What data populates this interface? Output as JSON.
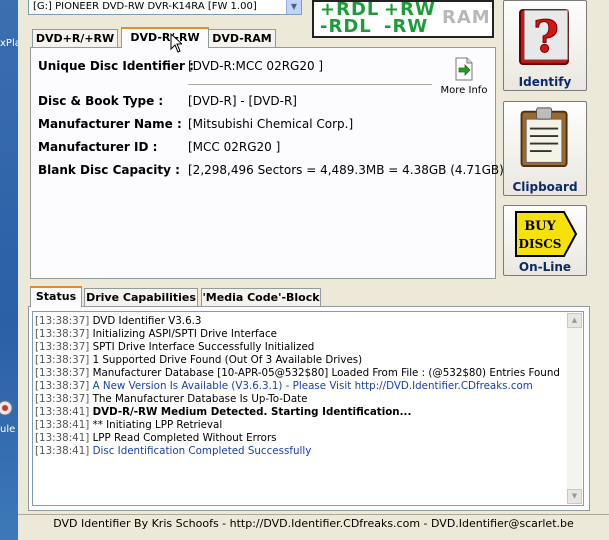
{
  "desktop": {
    "top_label": "xPla",
    "bottom_label": "ule"
  },
  "drive": {
    "selected": "[G:] PIONEER DVD-RW  DVR-K14RA [FW 1.00]"
  },
  "formats": {
    "plus_rdl": "+RDL",
    "plus_rw": "+RW",
    "minus_rdl": "-RDL",
    "minus_rw": "-RW",
    "ram": "RAM"
  },
  "tabs": {
    "t1": "DVD+R/+RW",
    "t2": "DVD-R/-RW",
    "t3": "DVD-RAM"
  },
  "disc": {
    "udi_label": "Unique Disc Identifier :",
    "udi_value": "[DVD-R:MCC 02RG20  ]",
    "more_info": "More Info",
    "type_label": "Disc & Book Type :",
    "type_value": "[DVD-R] - [DVD-R]",
    "mfr_label": "Manufacturer Name :",
    "mfr_value": "[Mitsubishi Chemical Corp.]",
    "mfrid_label": "Manufacturer ID :",
    "mfrid_value": "[MCC 02RG20  ]",
    "cap_label": "Blank Disc Capacity :",
    "cap_value": "[2,298,496 Sectors = 4,489.3MB = 4.38GB (4.71GB)]"
  },
  "side_buttons": {
    "identify": "Identify",
    "clipboard": "Clipboard",
    "online": "On-Line",
    "buy_text1": "BUY",
    "buy_text2": "DISCS"
  },
  "bottom_tabs": {
    "status": "Status",
    "caps": "Drive Capabilities",
    "media": "'Media Code'-Block"
  },
  "log": [
    {
      "ts": "[13:38:37]",
      "msg": "DVD Identifier V3.6.3",
      "style": ""
    },
    {
      "ts": "[13:38:37]",
      "msg": "Initializing ASPI/SPTI Drive Interface",
      "style": ""
    },
    {
      "ts": "[13:38:37]",
      "msg": "SPTI Drive Interface Successfully Initialized",
      "style": ""
    },
    {
      "ts": "[13:38:37]",
      "msg": "1 Supported Drive Found (Out Of 3 Available Drives)",
      "style": ""
    },
    {
      "ts": "[13:38:37]",
      "msg": "Manufacturer Database [10-APR-05@532$80] Loaded From File : (@532$80) Entries Found",
      "style": ""
    },
    {
      "ts": "[13:38:37]",
      "msg": "A New Version Is Available (V3.6.3.1) - Please Visit http://DVD.Identifier.CDfreaks.com",
      "style": "blue"
    },
    {
      "ts": "[13:38:37]",
      "msg": "The Manufacturer Database Is Up-To-Date",
      "style": ""
    },
    {
      "ts": "[13:38:41]",
      "msg": "DVD-R/-RW Medium Detected. Starting Identification...",
      "style": "bold"
    },
    {
      "ts": "[13:38:41]",
      "msg": "** Initiating LPP Retrieval",
      "style": ""
    },
    {
      "ts": "[13:38:41]",
      "msg": "LPP Read Completed Without Errors",
      "style": ""
    },
    {
      "ts": "[13:38:41]",
      "msg": "Disc Identification Completed Successfully",
      "style": "blue"
    }
  ],
  "footer": "DVD Identifier By Kris Schoofs  -  http://DVD.Identifier.CDfreaks.com  -  DVD.Identifier@scarlet.be"
}
